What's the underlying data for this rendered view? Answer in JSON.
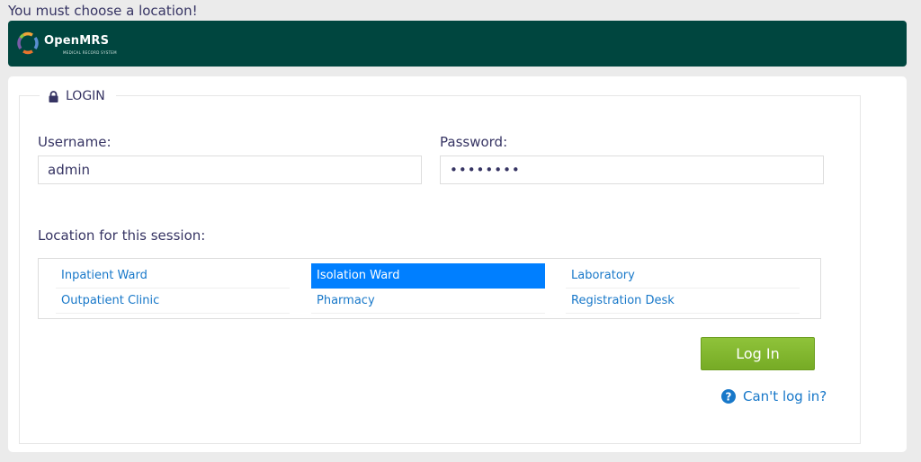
{
  "error": {
    "message": "You must choose a location!"
  },
  "header": {
    "logo_text": "OpenMRS",
    "logo_subtext": "MEDICAL RECORD SYSTEM",
    "bg_color": "#00463f"
  },
  "login": {
    "legend": "LOGIN",
    "legend_icon": "lock-icon",
    "username_label": "Username:",
    "username_value": "admin",
    "password_label": "Password:",
    "password_value": "••••••••",
    "location_label": "Location for this session:",
    "locations": [
      {
        "label": "Inpatient Ward",
        "selected": false
      },
      {
        "label": "Isolation Ward",
        "selected": true
      },
      {
        "label": "Laboratory",
        "selected": false
      },
      {
        "label": "Outpatient Clinic",
        "selected": false
      },
      {
        "label": "Pharmacy",
        "selected": false
      },
      {
        "label": "Registration Desk",
        "selected": false
      }
    ],
    "login_button": "Log In",
    "cant_login": "Can't log in?",
    "cant_login_icon": "question-circle-icon"
  },
  "colors": {
    "accent": "#007fff",
    "link": "#1878c9",
    "button_green": "#88bc34",
    "text": "#363463"
  }
}
